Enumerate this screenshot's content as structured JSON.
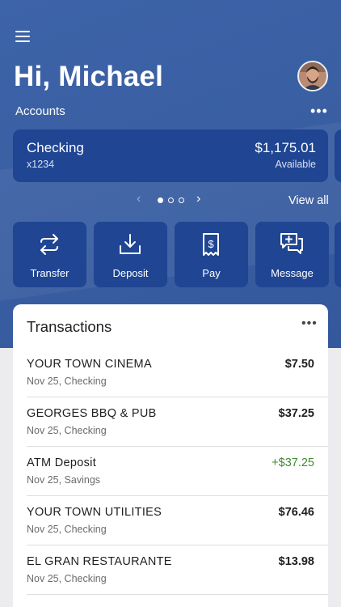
{
  "header": {
    "menu_icon": "hamburger-menu-icon",
    "greeting": "Hi, Michael",
    "avatar_icon": "user-avatar",
    "accounts_label": "Accounts",
    "accounts_more_icon": "more-horizontal-icon"
  },
  "account": {
    "name": "Checking",
    "number": "x1234",
    "balance": "$1,175.01",
    "balance_label": "Available"
  },
  "carousel": {
    "prev_icon": "chevron-left-icon",
    "next_icon": "chevron-right-icon",
    "pages": 3,
    "active_page": 1,
    "view_all": "View all"
  },
  "actions": [
    {
      "label": "Transfer",
      "icon": "transfer-icon"
    },
    {
      "label": "Deposit",
      "icon": "deposit-icon"
    },
    {
      "label": "Pay",
      "icon": "pay-bill-icon"
    },
    {
      "label": "Message",
      "icon": "message-icon"
    }
  ],
  "transactions": {
    "title": "Transactions",
    "more_icon": "more-horizontal-icon",
    "items": [
      {
        "merchant": "YOUR TOWN CINEMA",
        "meta": "Nov 25, Checking",
        "amount": "$7.50"
      },
      {
        "merchant": "GEORGES BBQ & PUB",
        "meta": "Nov 25, Checking",
        "amount": "$37.25"
      },
      {
        "merchant": "ATM Deposit",
        "meta": "Nov 25, Savings",
        "amount": "+$37.25"
      },
      {
        "merchant": "YOUR TOWN UTILITIES",
        "meta": "Nov 25, Checking",
        "amount": "$76.46"
      },
      {
        "merchant": "EL GRAN RESTAURANTE",
        "meta": "Nov 25, Checking",
        "amount": "$13.98"
      }
    ]
  },
  "colors": {
    "header_bg": "#3a5fa3",
    "card_bg": "#1f4593",
    "credit": "#3f8a2e"
  }
}
